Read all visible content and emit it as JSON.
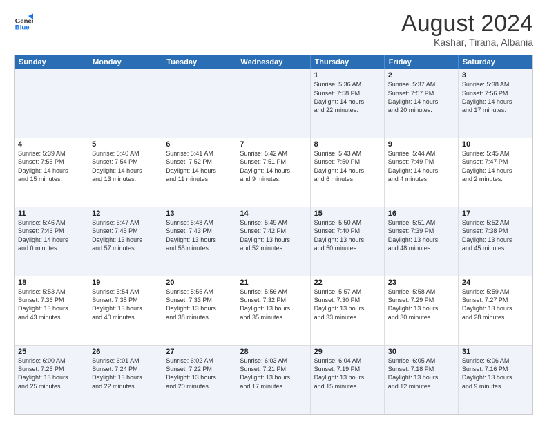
{
  "header": {
    "logo_general": "General",
    "logo_blue": "Blue",
    "month_year": "August 2024",
    "location": "Kashar, Tirana, Albania"
  },
  "weekdays": [
    "Sunday",
    "Monday",
    "Tuesday",
    "Wednesday",
    "Thursday",
    "Friday",
    "Saturday"
  ],
  "rows": [
    [
      {
        "day": "",
        "text": ""
      },
      {
        "day": "",
        "text": ""
      },
      {
        "day": "",
        "text": ""
      },
      {
        "day": "",
        "text": ""
      },
      {
        "day": "1",
        "text": "Sunrise: 5:36 AM\nSunset: 7:58 PM\nDaylight: 14 hours\nand 22 minutes."
      },
      {
        "day": "2",
        "text": "Sunrise: 5:37 AM\nSunset: 7:57 PM\nDaylight: 14 hours\nand 20 minutes."
      },
      {
        "day": "3",
        "text": "Sunrise: 5:38 AM\nSunset: 7:56 PM\nDaylight: 14 hours\nand 17 minutes."
      }
    ],
    [
      {
        "day": "4",
        "text": "Sunrise: 5:39 AM\nSunset: 7:55 PM\nDaylight: 14 hours\nand 15 minutes."
      },
      {
        "day": "5",
        "text": "Sunrise: 5:40 AM\nSunset: 7:54 PM\nDaylight: 14 hours\nand 13 minutes."
      },
      {
        "day": "6",
        "text": "Sunrise: 5:41 AM\nSunset: 7:52 PM\nDaylight: 14 hours\nand 11 minutes."
      },
      {
        "day": "7",
        "text": "Sunrise: 5:42 AM\nSunset: 7:51 PM\nDaylight: 14 hours\nand 9 minutes."
      },
      {
        "day": "8",
        "text": "Sunrise: 5:43 AM\nSunset: 7:50 PM\nDaylight: 14 hours\nand 6 minutes."
      },
      {
        "day": "9",
        "text": "Sunrise: 5:44 AM\nSunset: 7:49 PM\nDaylight: 14 hours\nand 4 minutes."
      },
      {
        "day": "10",
        "text": "Sunrise: 5:45 AM\nSunset: 7:47 PM\nDaylight: 14 hours\nand 2 minutes."
      }
    ],
    [
      {
        "day": "11",
        "text": "Sunrise: 5:46 AM\nSunset: 7:46 PM\nDaylight: 14 hours\nand 0 minutes."
      },
      {
        "day": "12",
        "text": "Sunrise: 5:47 AM\nSunset: 7:45 PM\nDaylight: 13 hours\nand 57 minutes."
      },
      {
        "day": "13",
        "text": "Sunrise: 5:48 AM\nSunset: 7:43 PM\nDaylight: 13 hours\nand 55 minutes."
      },
      {
        "day": "14",
        "text": "Sunrise: 5:49 AM\nSunset: 7:42 PM\nDaylight: 13 hours\nand 52 minutes."
      },
      {
        "day": "15",
        "text": "Sunrise: 5:50 AM\nSunset: 7:40 PM\nDaylight: 13 hours\nand 50 minutes."
      },
      {
        "day": "16",
        "text": "Sunrise: 5:51 AM\nSunset: 7:39 PM\nDaylight: 13 hours\nand 48 minutes."
      },
      {
        "day": "17",
        "text": "Sunrise: 5:52 AM\nSunset: 7:38 PM\nDaylight: 13 hours\nand 45 minutes."
      }
    ],
    [
      {
        "day": "18",
        "text": "Sunrise: 5:53 AM\nSunset: 7:36 PM\nDaylight: 13 hours\nand 43 minutes."
      },
      {
        "day": "19",
        "text": "Sunrise: 5:54 AM\nSunset: 7:35 PM\nDaylight: 13 hours\nand 40 minutes."
      },
      {
        "day": "20",
        "text": "Sunrise: 5:55 AM\nSunset: 7:33 PM\nDaylight: 13 hours\nand 38 minutes."
      },
      {
        "day": "21",
        "text": "Sunrise: 5:56 AM\nSunset: 7:32 PM\nDaylight: 13 hours\nand 35 minutes."
      },
      {
        "day": "22",
        "text": "Sunrise: 5:57 AM\nSunset: 7:30 PM\nDaylight: 13 hours\nand 33 minutes."
      },
      {
        "day": "23",
        "text": "Sunrise: 5:58 AM\nSunset: 7:29 PM\nDaylight: 13 hours\nand 30 minutes."
      },
      {
        "day": "24",
        "text": "Sunrise: 5:59 AM\nSunset: 7:27 PM\nDaylight: 13 hours\nand 28 minutes."
      }
    ],
    [
      {
        "day": "25",
        "text": "Sunrise: 6:00 AM\nSunset: 7:25 PM\nDaylight: 13 hours\nand 25 minutes."
      },
      {
        "day": "26",
        "text": "Sunrise: 6:01 AM\nSunset: 7:24 PM\nDaylight: 13 hours\nand 22 minutes."
      },
      {
        "day": "27",
        "text": "Sunrise: 6:02 AM\nSunset: 7:22 PM\nDaylight: 13 hours\nand 20 minutes."
      },
      {
        "day": "28",
        "text": "Sunrise: 6:03 AM\nSunset: 7:21 PM\nDaylight: 13 hours\nand 17 minutes."
      },
      {
        "day": "29",
        "text": "Sunrise: 6:04 AM\nSunset: 7:19 PM\nDaylight: 13 hours\nand 15 minutes."
      },
      {
        "day": "30",
        "text": "Sunrise: 6:05 AM\nSunset: 7:18 PM\nDaylight: 13 hours\nand 12 minutes."
      },
      {
        "day": "31",
        "text": "Sunrise: 6:06 AM\nSunset: 7:16 PM\nDaylight: 13 hours\nand 9 minutes."
      }
    ]
  ]
}
